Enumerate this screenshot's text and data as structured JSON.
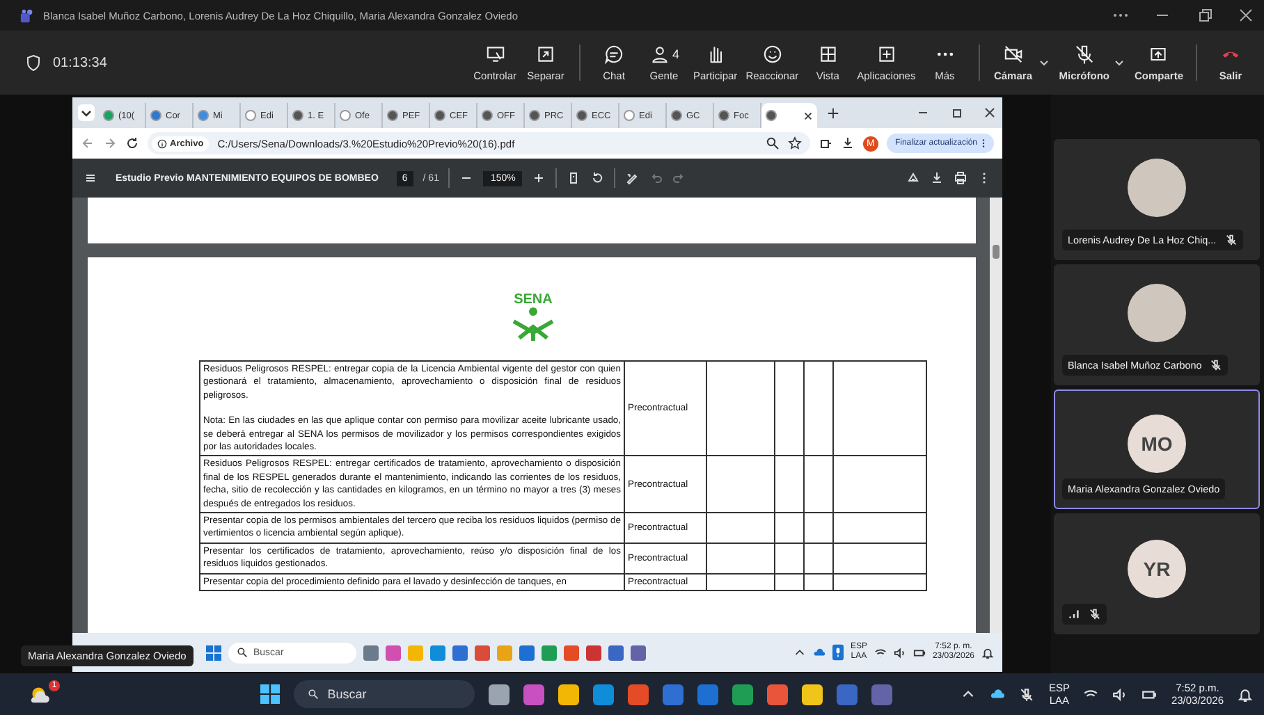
{
  "window": {
    "title": "Blanca Isabel Muñoz Carbono, Lorenis Audrey De La Hoz Chiquillo, Maria Alexandra Gonzalez Oviedo"
  },
  "meeting": {
    "timer": "01:13:34",
    "toolbar_groups": [
      [
        {
          "label": "Controlar"
        },
        {
          "label": "Separar"
        }
      ],
      [
        {
          "label": "Chat"
        },
        {
          "label": "Gente",
          "count": "4"
        },
        {
          "label": "Participar"
        },
        {
          "label": "Reaccionar"
        },
        {
          "label": "Vista"
        },
        {
          "label": "Aplicaciones"
        },
        {
          "label": "Más"
        }
      ],
      [
        {
          "label": "Cámara",
          "on": false
        },
        {
          "label": "Micrófono",
          "on": false
        },
        {
          "label": "Comparte"
        }
      ],
      [
        {
          "label": "Salir"
        }
      ]
    ]
  },
  "shared_screen": {
    "browser": {
      "tabs": [
        {
          "label": "(10(",
          "selected": false
        },
        {
          "label": "Cor",
          "selected": false
        },
        {
          "label": "Mi",
          "selected": false
        },
        {
          "label": "Edi",
          "selected": false
        },
        {
          "label": "1. E",
          "selected": false
        },
        {
          "label": "Ofe",
          "selected": false
        },
        {
          "label": "PEF",
          "selected": false
        },
        {
          "label": "CEF",
          "selected": false
        },
        {
          "label": "OFF",
          "selected": false
        },
        {
          "label": "PRC",
          "selected": false
        },
        {
          "label": "ECC",
          "selected": false
        },
        {
          "label": "Edi",
          "selected": false
        },
        {
          "label": "GC",
          "selected": false
        },
        {
          "label": "Foc",
          "selected": false
        },
        {
          "selected": true
        }
      ],
      "address": {
        "chip": "Archivo",
        "url": "C:/Users/Sena/Downloads/3.%20Estudio%20Previo%20(16).pdf"
      },
      "profile_initial": "M",
      "update_button": "Finalizar actualización"
    },
    "pdf_viewer": {
      "title": "Estudio Previo MANTENIMIENTO EQUIPOS DE BOMBEO",
      "page": "6",
      "page_total": "/ 61",
      "zoom": "150%",
      "logo_text": "SENA",
      "table_rows": [
        {
          "paragraphs": [
            "Residuos Peligrosos RESPEL: entregar copia de la Licencia Ambiental vigente del gestor con quien gestionará el tratamiento, almacenamiento, aprovechamiento o disposición final de residuos peligrosos.",
            "Nota: En las ciudades en las que aplique contar con permiso para movilizar aceite lubricante usado, se deberá entregar al SENA los permisos de movilizador y los permisos correspondientes exigidos por las autoridades locales."
          ],
          "phase": "Precontractual"
        },
        {
          "paragraphs": [
            "Residuos Peligrosos RESPEL: entregar certificados de tratamiento, aprovechamiento o disposición final de los RESPEL generados durante el mantenimiento, indicando las corrientes de los residuos, fecha, sitio de recolección y las cantidades en kilogramos, en un término no mayor a tres (3) meses después de entregados los residuos."
          ],
          "phase": "Precontractual"
        },
        {
          "paragraphs": [
            "Presentar copia de los permisos ambientales del tercero que reciba los residuos liquidos (permiso de vertimientos o licencia ambiental según aplique)."
          ],
          "phase": "Precontractual"
        },
        {
          "paragraphs": [
            "Presentar los certificados de tratamiento, aprovechamiento, reúso y/o disposición final de los residuos liquidos gestionados."
          ],
          "phase": "Precontractual"
        },
        {
          "paragraphs": [
            "Presentar copia del procedimiento definido para el lavado y desinfección de tanques, en"
          ],
          "phase": "Precontractual"
        }
      ]
    },
    "taskbar": {
      "search": "Buscar",
      "language": "ESP",
      "layout": "LAA",
      "time": "7:52 p. m.",
      "date": "23/03/2026"
    },
    "presenter_label": "Maria Alexandra Gonzalez Oviedo"
  },
  "participants": [
    {
      "name": "Lorenis Audrey De La Hoz Chiq...",
      "muted": true,
      "selected": false,
      "signal_warning": false
    },
    {
      "name": "Blanca Isabel Muñoz Carbono",
      "muted": true,
      "selected": false,
      "signal_warning": false
    },
    {
      "name": "Maria Alexandra Gonzalez Oviedo",
      "initials": "MO",
      "muted": false,
      "selected": true,
      "signal_warning": false
    },
    {
      "initials": "YR",
      "muted": true,
      "selected": false,
      "signal_warning": true
    }
  ],
  "taskbar": {
    "weather_badge": "1",
    "search": "Buscar",
    "language": "ESP",
    "layout": "LAA",
    "time": "7:52 p.m.",
    "date": "23/03/2026"
  }
}
